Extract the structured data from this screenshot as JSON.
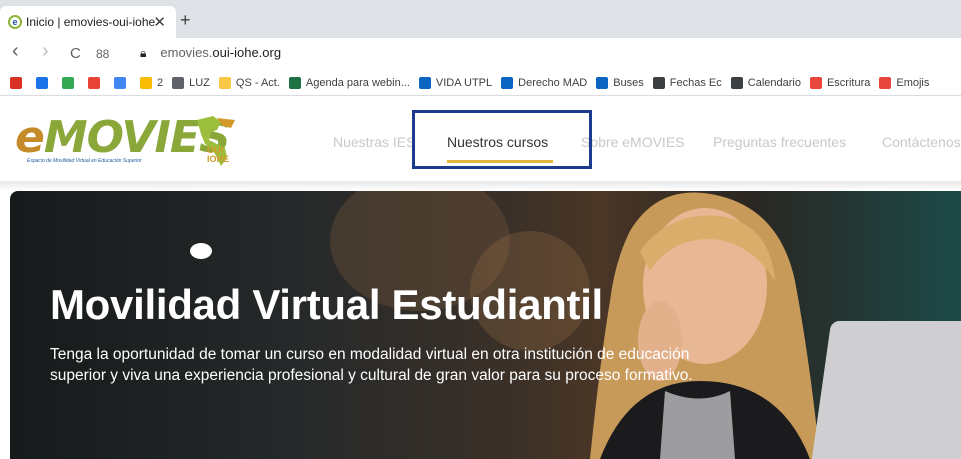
{
  "browser": {
    "tab_title": "Inicio | emovies-oui-iohe",
    "tab_close": "✕",
    "new_tab": "+",
    "url_prefix": "emovies.",
    "url_domain": "oui-iohe.org",
    "nav": {
      "back": "‹",
      "forward": "›",
      "reload": "C",
      "apps": "88"
    }
  },
  "bookmarks": [
    {
      "label": "",
      "color": "#d93025"
    },
    {
      "label": "",
      "color": "#1a73e8"
    },
    {
      "label": "",
      "color": "#34a853"
    },
    {
      "label": "",
      "color": "#ea4335"
    },
    {
      "label": "",
      "color": "#4285f4"
    },
    {
      "label": "2",
      "color": "#fbbc04"
    },
    {
      "label": "LUZ",
      "color": "#5f6368"
    },
    {
      "label": "QS - Act.",
      "color": "#f9c846"
    },
    {
      "label": "Agenda para webin...",
      "color": "#1e7145"
    },
    {
      "label": "VIDA UTPL",
      "color": "#0a66c2"
    },
    {
      "label": "Derecho MAD",
      "color": "#0a66c2"
    },
    {
      "label": "Buses",
      "color": "#0a66c2"
    },
    {
      "label": "Fechas Ec",
      "color": "#3c4043"
    },
    {
      "label": "Calendario",
      "color": "#3c4043"
    },
    {
      "label": "Escritura",
      "color": "#e8453c"
    },
    {
      "label": "Emojis",
      "color": "#e8453c"
    }
  ],
  "site": {
    "logo_text_e": "e",
    "logo_text_rest": "MOVIES",
    "logo_subtitle": "Espacio de Movilidad Virtual en Educación Superior",
    "logo_oui": "OUI",
    "logo_iohe": "IOHE",
    "menu": [
      {
        "label": "Nuestras IES"
      },
      {
        "label": "Nuestros cursos"
      },
      {
        "label": "Sobre eMOVIES"
      },
      {
        "label": "Preguntas frecuentes"
      },
      {
        "label": "Contáctenos"
      }
    ],
    "active_menu": "Nuestros cursos"
  },
  "hero": {
    "title": "Movilidad Virtual Estudiantil",
    "description": "Tenga la oportunidad de tomar un curso en modalidad virtual en otra institución de educación superior y viva una experiencia profesional y cultural de gran valor para su proceso formativo."
  },
  "colors": {
    "accent_underline": "#e2b53c",
    "highlight_box": "#1b3c8e",
    "logo_green": "#8aa83a",
    "logo_gold": "#c58b2a"
  }
}
